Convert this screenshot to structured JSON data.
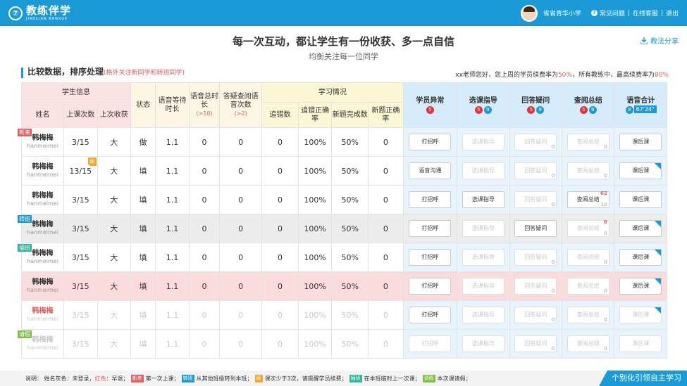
{
  "topbar": {
    "logo_mark": "⑦",
    "logo_cn": "教练伴学",
    "logo_en": "JIAOLIAN BANXUE",
    "school": "省省青华小学",
    "help": "常见问题",
    "support": "在线客服",
    "logout": "退出",
    "separator": "|"
  },
  "headline": "每一次互动，都让学生有一份收获、多一点自信",
  "subline": "均衡关注每一位同学",
  "share": "教法分享",
  "section": {
    "title": "比较数据，排序处理",
    "note": "(格外关注新同学和转班同学)"
  },
  "teacher_msg": {
    "prefix": "xx老师您好，您上周的学员续费率为",
    "own_rate": "50%",
    "middle": "，所有教练中，最高续费率为",
    "max_rate": "80%"
  },
  "table": {
    "groups": {
      "student_info": "学生信息",
      "status": "状态",
      "voice_wait": "语音等待时长",
      "voice_total": "语音总时长",
      "voice_total_sub": "(>10)",
      "answer_count": "答疑查阅语音次数",
      "answer_count_sub": "(>2)",
      "study": "学习情况",
      "abnormal": "学员异常",
      "course_guide": "选课指导",
      "answer_q": "回答疑问",
      "review": "查阅总结",
      "voice_sum": "语音合计"
    },
    "cols": {
      "name": "姓名",
      "classes": "上课次数",
      "last_gain": "上次收获",
      "wrong": "追错数",
      "wrong_rate": "追错正确率",
      "new_done": "新题完成数",
      "new_rate": "新题正确率"
    },
    "badges": {
      "abnormal": [
        "5"
      ],
      "course_guide": [
        "5",
        "9"
      ],
      "answer_q": [
        "5",
        "9"
      ],
      "review": [
        "5",
        "9"
      ],
      "voice_sum_num": "9",
      "voice_sum_time": "67'24\""
    },
    "rows": [
      {
        "tag": "新来",
        "cn": "韩梅梅",
        "en": "hanmeimei",
        "classes": "3/15",
        "gain": "大",
        "status": "做",
        "wait": "1.1",
        "total": "0",
        "answer": "0",
        "wrong": "0",
        "wrong_rate": "100%",
        "new_done": "50%",
        "new_rate": "0",
        "b1": "打招呼",
        "b2": "选课指导",
        "b3": "回答疑问",
        "b3_sub": "0",
        "b4": "查阅总结",
        "b4_sub": "0",
        "b4_sup": "",
        "b5": "课后课"
      },
      {
        "tag": "续",
        "cn": "韩梅梅",
        "en": "hanmeimei",
        "classes": "13/15",
        "gain": "大",
        "status": "填",
        "wait": "1.1",
        "total": "0",
        "answer": "0",
        "wrong": "0",
        "wrong_rate": "100%",
        "new_done": "50%",
        "new_rate": "0",
        "b1": "语音沟通",
        "b2": "选课指导",
        "b3": "回答疑问",
        "b3_sub": "0",
        "b4": "查阅总结",
        "b4_sub": "0",
        "b4_sup": "",
        "b5": "课后课"
      },
      {
        "tag": "",
        "cn": "韩梅梅",
        "en": "hanmeimei",
        "classes": "3/15",
        "gain": "大",
        "status": "填",
        "wait": "1.1",
        "total": "0",
        "answer": "0",
        "wrong": "0",
        "wrong_rate": "100%",
        "new_done": "50%",
        "new_rate": "0",
        "b1": "打招呼",
        "b2": "选课指导",
        "b3": "回答疑问",
        "b3_sub": "0",
        "b4": "查阅总结",
        "b4_sub": "10",
        "b4_sup": "62",
        "b5": "课后课"
      },
      {
        "tag": "转班",
        "cn": "韩梅梅",
        "en": "hanmeimei",
        "classes": "3/15",
        "gain": "大",
        "status": "填",
        "wait": "1.1",
        "total": "0",
        "answer": "0",
        "wrong": "0",
        "wrong_rate": "100%",
        "new_done": "50%",
        "new_rate": "0",
        "b1": "打招呼",
        "b2": "选课指导",
        "b3": "回答疑问",
        "b3_sub": "",
        "b4": "查阅总结",
        "b4_sub": "0",
        "b4_sup": "6",
        "b5": "课后课"
      },
      {
        "tag": "插班",
        "cn": "韩梅梅",
        "en": "hanmeimei",
        "classes": "3/15",
        "gain": "大",
        "status": "填",
        "wait": "1.1",
        "total": "0",
        "answer": "0",
        "wrong": "0",
        "wrong_rate": "100%",
        "new_done": "50%",
        "new_rate": "0",
        "b1": "打招呼",
        "b2": "选课指导",
        "b3": "回答疑问",
        "b3_sub": "0",
        "b4": "查阅总结",
        "b4_sub": "0",
        "b4_sup": "",
        "b5": "课后课"
      },
      {
        "tag": "",
        "cn": "韩梅梅",
        "en": "hanmeimei",
        "classes": "3/15",
        "gain": "大",
        "status": "填",
        "wait": "1.1",
        "total": "0",
        "answer": "0",
        "wrong": "0",
        "wrong_rate": "100%",
        "new_done": "50%",
        "new_rate": "0",
        "b1": "打招呼",
        "b2": "选课指导",
        "b3": "回答疑问",
        "b3_sub": "0",
        "b4": "查阅总结",
        "b4_sub": "0",
        "b4_sup": "",
        "b5": "课后课"
      },
      {
        "tag": "",
        "cn": "韩梅梅",
        "en": "hanmeimei",
        "classes": "3/15",
        "gain": "大",
        "status": "填",
        "wait": "1.1",
        "total": "0",
        "answer": "0",
        "wrong": "0",
        "wrong_rate": "100%",
        "new_done": "50%",
        "new_rate": "0",
        "b1": "打招呼",
        "b2": "选课指导",
        "b3": "回答疑问",
        "b3_sub": "0",
        "b4": "查阅总结",
        "b4_sub": "0",
        "b4_sup": "",
        "b5": "课后课"
      },
      {
        "tag": "请假",
        "cn": "韩梅梅",
        "en": "hanmeimei",
        "classes": "3/15",
        "gain": "大",
        "status": "填",
        "wait": "1.1",
        "total": "0",
        "answer": "0",
        "wrong": "0",
        "wrong_rate": "100%",
        "new_done": "50%",
        "new_rate": "0",
        "b1": "打招呼",
        "b2": "选课指导",
        "b3": "回答疑问",
        "b3_sub": "0",
        "b4": "查阅总结",
        "b4_sub": "0",
        "b4_sup": "",
        "b5": "课后课"
      }
    ]
  },
  "footer": {
    "lead": "说明： 姓名灰色：未登录，",
    "red_word": "红色",
    "lead2": "：早退；",
    "new_tag": "新来",
    "new_desc": "第一次上课；",
    "transfer_tag": "转班",
    "transfer_desc": "从其他班级转到本班；",
    "cont_tag": "续",
    "cont_desc": "课次少于3次，请提醒学员续费；",
    "insert_tag": "插班",
    "insert_desc": "在本班临时上一次课；",
    "leave_tag": "请假",
    "leave_desc": "本次课请假；",
    "slogan": "个别化引领自主学习"
  },
  "colors": {
    "primary": "#1a9bd7",
    "accent_red": "#e85c5c",
    "badge_red": "#e8313a",
    "continue_orange": "#f5a623",
    "insert_green": "#2bb89a",
    "leave_green": "#7fbe3e"
  }
}
